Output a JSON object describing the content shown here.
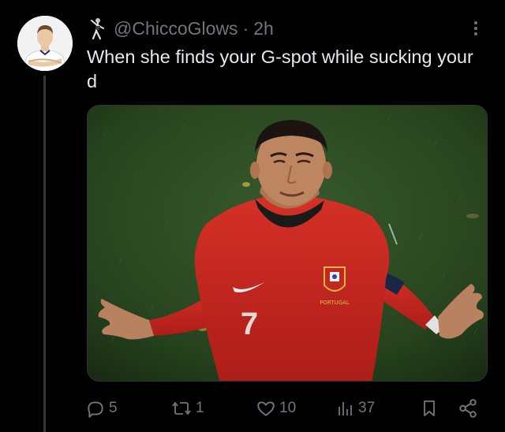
{
  "tweet": {
    "author_emoji": "🕺",
    "handle": "@ChiccoGlows",
    "separator": "·",
    "time": "2h",
    "text": "When she finds your G-spot while sucking your d"
  },
  "media": {
    "jersey_number": "7",
    "crest_text": "PORTUGAL"
  },
  "actions": {
    "replies": "5",
    "reposts": "1",
    "likes": "10",
    "views": "37"
  },
  "colors": {
    "background": "#000000",
    "text": "#e7e9ea",
    "muted": "#71767b",
    "divider": "#333639"
  },
  "icons": {
    "reply": "reply-icon",
    "repost": "repost-icon",
    "like": "heart-icon",
    "views": "views-icon",
    "bookmark": "bookmark-icon",
    "share": "share-icon",
    "more": "more-icon"
  }
}
